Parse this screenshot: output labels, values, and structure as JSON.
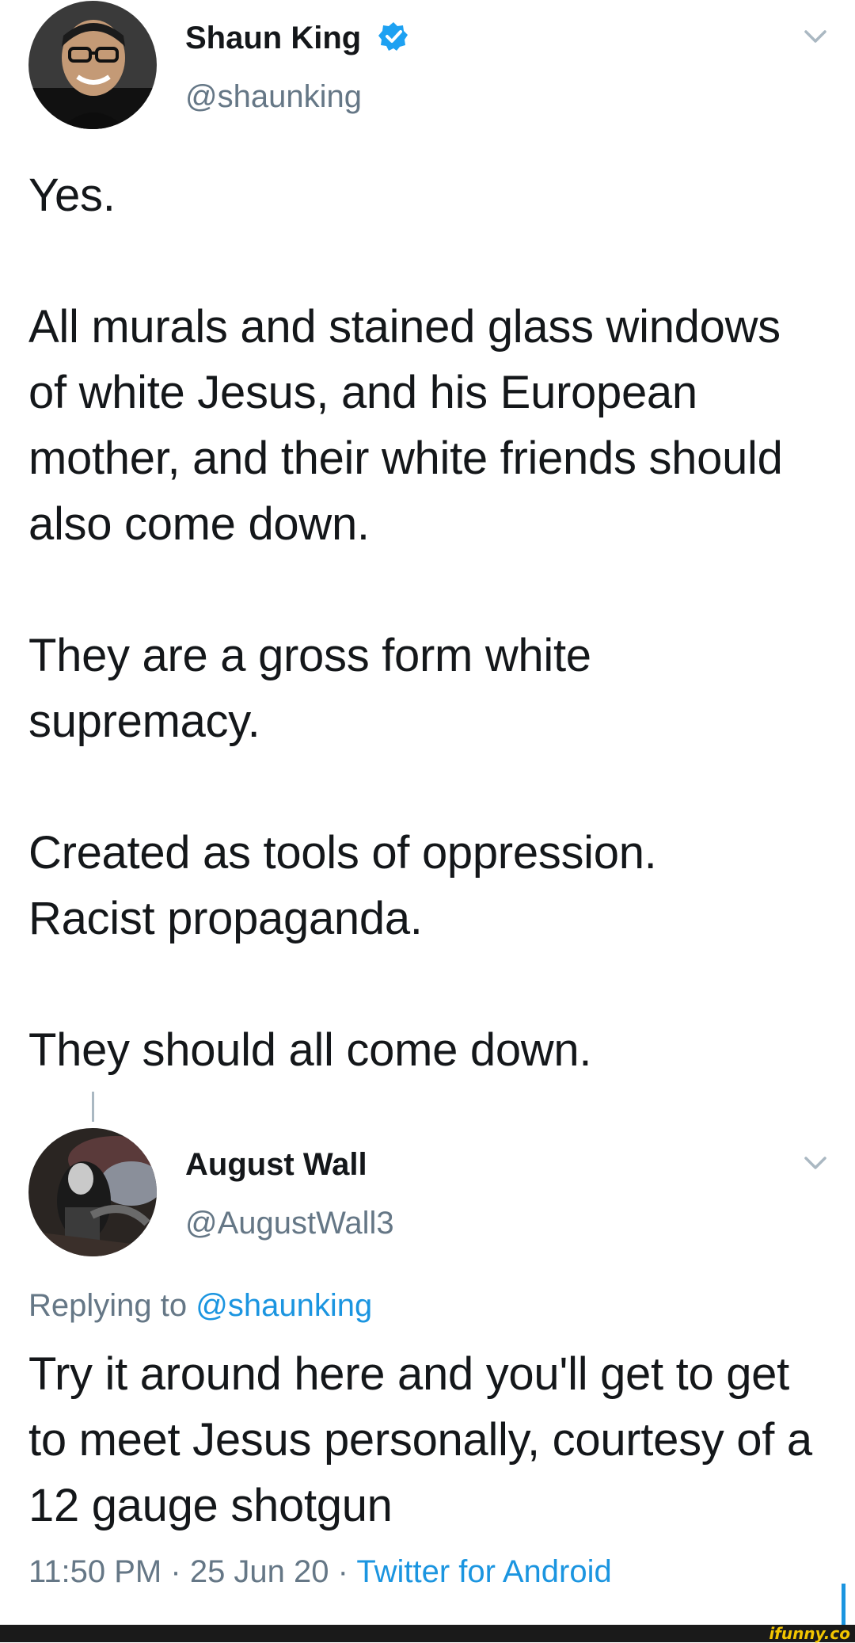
{
  "tweet": {
    "author_name": "Shaun King",
    "author_handle": "@shaunking",
    "avatar": "avatar-photo",
    "verified_icon": "verified-badge-icon",
    "menu_icon": "chevron-down-icon",
    "paragraphs": [
      "Yes.",
      "All murals and stained glass windows of white Jesus, and his European mother, and their white friends should also come down.",
      "They are a gross form white supremacy.",
      "Created as tools of oppression.\nRacist propaganda.",
      "They should all come down."
    ]
  },
  "reply": {
    "author_name": "August Wall",
    "author_handle": "@AugustWall3",
    "avatar": "avatar-photo",
    "menu_icon": "chevron-down-icon",
    "replying_prefix": "Replying to",
    "replying_handle": "@shaunking",
    "text": "Try it around here and you'll get to get to meet Jesus personally, courtesy of a 12 gauge shotgun",
    "time": "11:50 PM",
    "separator": "·",
    "date": "25 Jun 20",
    "source": "Twitter for Android"
  },
  "watermark": "ifunny.co",
  "colors": {
    "text": "#14171a",
    "secondary": "#657786",
    "link": "#1b95e0",
    "verified": "#1da1f2"
  }
}
